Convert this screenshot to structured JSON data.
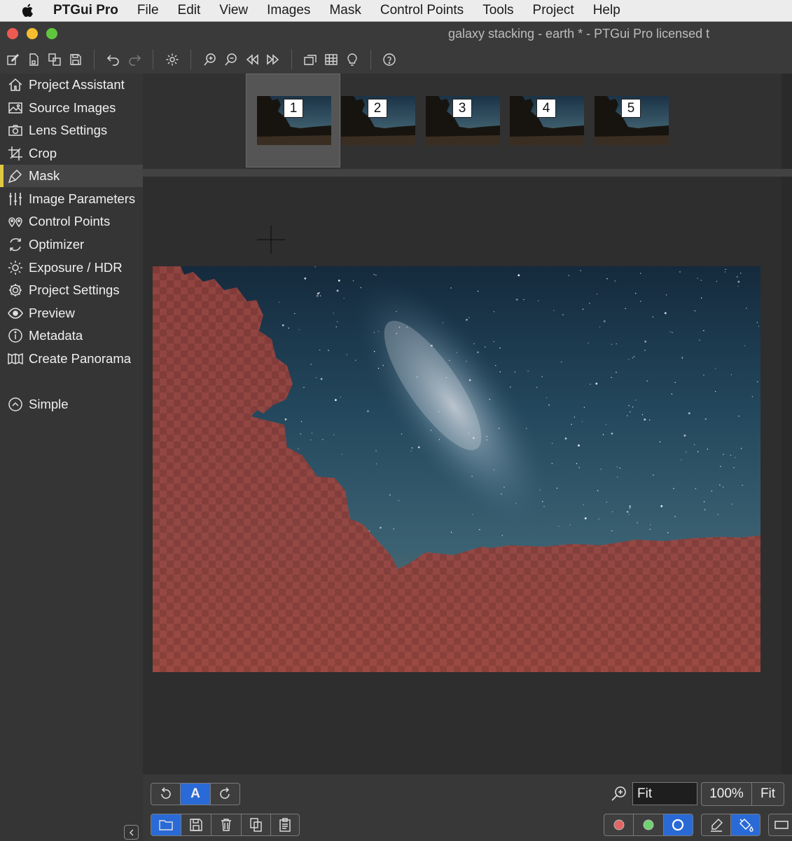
{
  "menubar": {
    "app_name": "PTGui Pro",
    "items": [
      "File",
      "Edit",
      "View",
      "Images",
      "Mask",
      "Control Points",
      "Tools",
      "Project",
      "Help"
    ]
  },
  "window": {
    "title": "galaxy stacking - earth * - PTGui Pro licensed t"
  },
  "toolbar": {
    "icons": [
      "new-project-icon",
      "open-icon",
      "duplicate-icon",
      "save-icon",
      "undo-icon",
      "redo-icon",
      "settings-icon",
      "zoom-in-icon",
      "zoom-out-icon",
      "previous-icon",
      "next-icon",
      "panorama-editor-icon",
      "table-icon",
      "bulb-icon",
      "help-icon"
    ]
  },
  "sidebar": {
    "items": [
      {
        "label": "Project Assistant",
        "icon": "home-icon"
      },
      {
        "label": "Source Images",
        "icon": "image-icon"
      },
      {
        "label": "Lens Settings",
        "icon": "camera-icon"
      },
      {
        "label": "Crop",
        "icon": "crop-icon"
      },
      {
        "label": "Mask",
        "icon": "brush-icon",
        "active": true
      },
      {
        "label": "Image Parameters",
        "icon": "sliders-icon"
      },
      {
        "label": "Control Points",
        "icon": "pins-icon"
      },
      {
        "label": "Optimizer",
        "icon": "optimizer-icon"
      },
      {
        "label": "Exposure / HDR",
        "icon": "sun-icon"
      },
      {
        "label": "Project Settings",
        "icon": "gear-icon"
      },
      {
        "label": "Preview",
        "icon": "eye-icon"
      },
      {
        "label": "Metadata",
        "icon": "info-icon"
      },
      {
        "label": "Create Panorama",
        "icon": "panorama-icon"
      }
    ],
    "mode": {
      "label": "Simple",
      "icon": "chevron-up-circle-icon"
    }
  },
  "thumbnails": {
    "selected": "1",
    "items": [
      "1",
      "2",
      "3",
      "4",
      "5"
    ]
  },
  "bottombar": {
    "rotate_group": {
      "auto_label": "A"
    },
    "zoom": {
      "field_value": "Fit",
      "btn_100": "100%",
      "btn_fit": "Fit"
    },
    "mask_colors": [
      "#e06666",
      "#6fd36f",
      "#ffffff"
    ],
    "colors": {
      "accent": "#2a6ad6",
      "mask_red": "#a04540",
      "active_marker": "#e1c842"
    }
  }
}
